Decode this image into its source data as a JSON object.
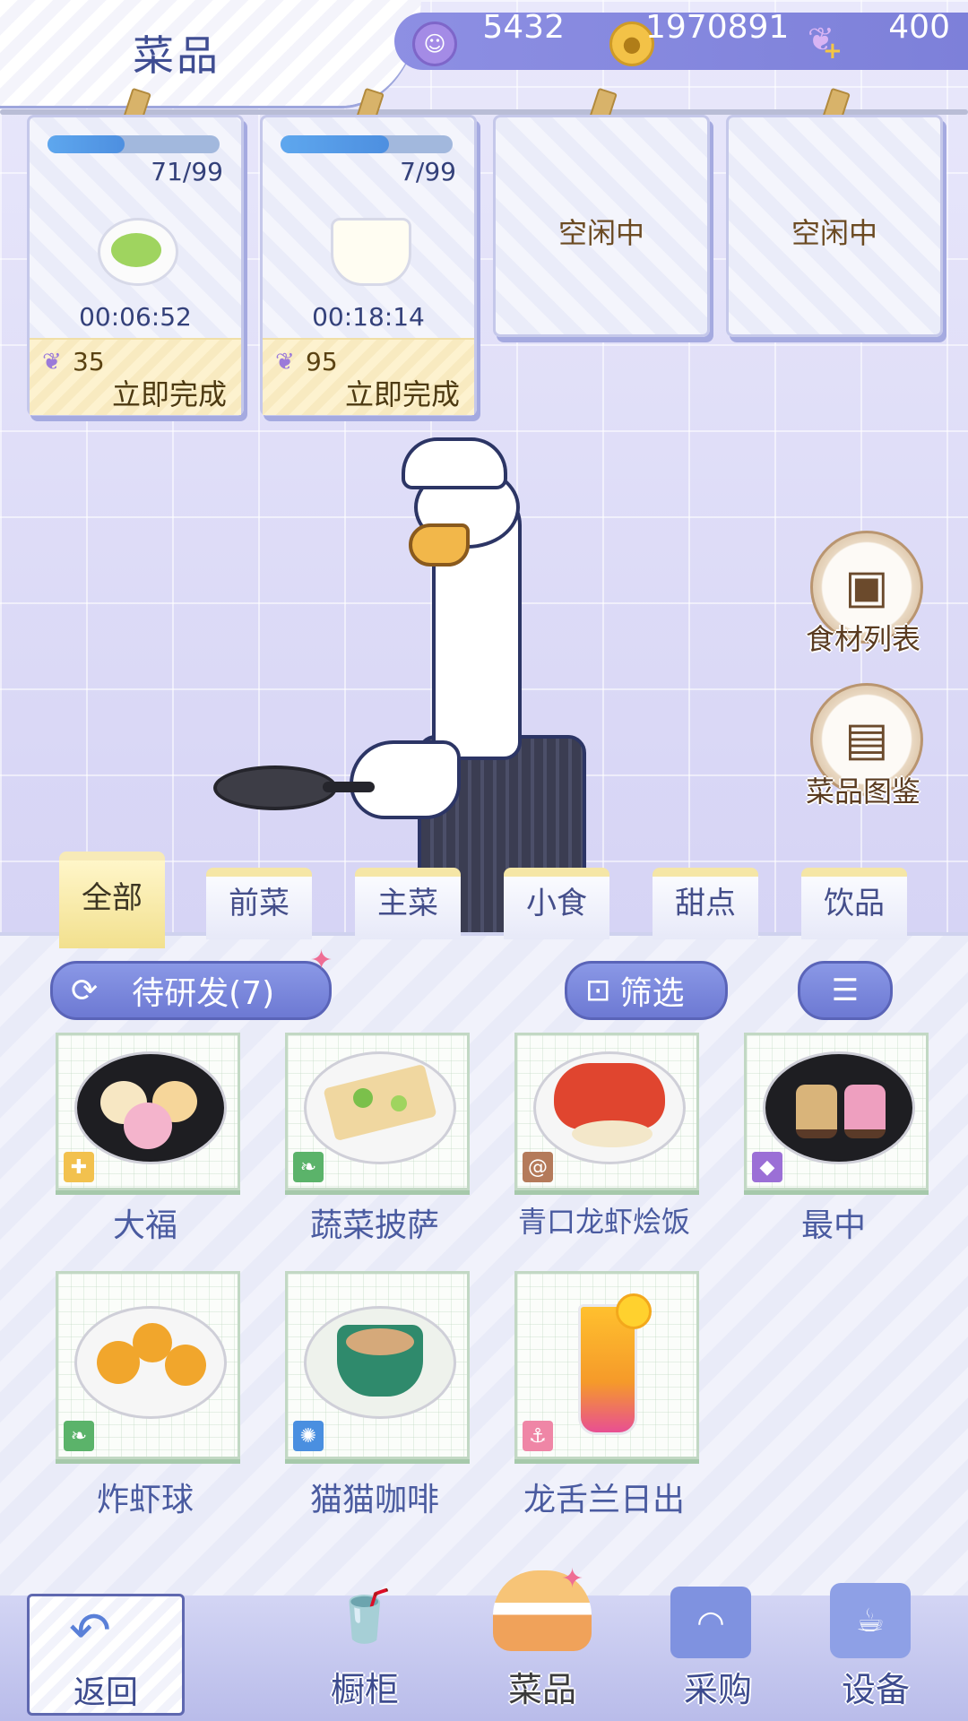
{
  "header": {
    "title": "菜品",
    "resources": [
      {
        "icon": "purple-coin-icon",
        "value": "5432"
      },
      {
        "icon": "gold-coin-icon",
        "value": "1970891"
      },
      {
        "icon": "crystal-swan-icon",
        "value": "400"
      }
    ],
    "add_icon": "plus-icon"
  },
  "orders": [
    {
      "progress_text": "71/99",
      "progress": 0.45,
      "dish": "green-soup-icon",
      "timer": "00:06:52",
      "cost": "35",
      "action": "立即完成"
    },
    {
      "progress_text": "7/99",
      "progress": 0.63,
      "dish": "milk-cup-icon",
      "timer": "00:18:14",
      "cost": "95",
      "action": "立即完成"
    },
    {
      "status": "空闲中"
    },
    {
      "status": "空闲中"
    }
  ],
  "side_buttons": [
    {
      "label": "食材列表",
      "icon": "box-icon"
    },
    {
      "label": "菜品图鉴",
      "icon": "recipe-book-icon"
    }
  ],
  "tabs": [
    {
      "label": "全部",
      "active": true
    },
    {
      "label": "前菜",
      "active": false
    },
    {
      "label": "主菜",
      "active": false
    },
    {
      "label": "小食",
      "active": false
    },
    {
      "label": "甜点",
      "active": false
    },
    {
      "label": "饮品",
      "active": false
    }
  ],
  "toolbar": {
    "pending_label": "待研发(7)",
    "filter_label": "筛选",
    "sort_icon": "sort-icon"
  },
  "dishes": [
    {
      "name": "大福",
      "tag_icon": "puzzle-icon",
      "tag_color": "#f2c14e"
    },
    {
      "name": "蔬菜披萨",
      "tag_icon": "leaf-icon",
      "tag_color": "#5bb36a"
    },
    {
      "name": "青口龙虾烩饭",
      "tag_icon": "shell-icon",
      "tag_color": "#b47a5a"
    },
    {
      "name": "最中",
      "tag_icon": "diamond-icon",
      "tag_color": "#9b6fd6"
    },
    {
      "name": "炸虾球",
      "tag_icon": "leaf-icon",
      "tag_color": "#5bb36a"
    },
    {
      "name": "猫猫咖啡",
      "tag_icon": "bulb-icon",
      "tag_color": "#4a8fe0"
    },
    {
      "name": "龙舌兰日出",
      "tag_icon": "anchor-icon",
      "tag_color": "#ef86a6"
    }
  ],
  "bottom_nav": {
    "back_label": "返回",
    "items": [
      {
        "label": "橱柜",
        "icon": "drinks-icon",
        "active": false
      },
      {
        "label": "菜品",
        "icon": "burger-icon",
        "active": true
      },
      {
        "label": "采购",
        "icon": "shopping-bag-icon",
        "active": false
      },
      {
        "label": "设备",
        "icon": "coffee-machine-icon",
        "active": false
      }
    ]
  }
}
